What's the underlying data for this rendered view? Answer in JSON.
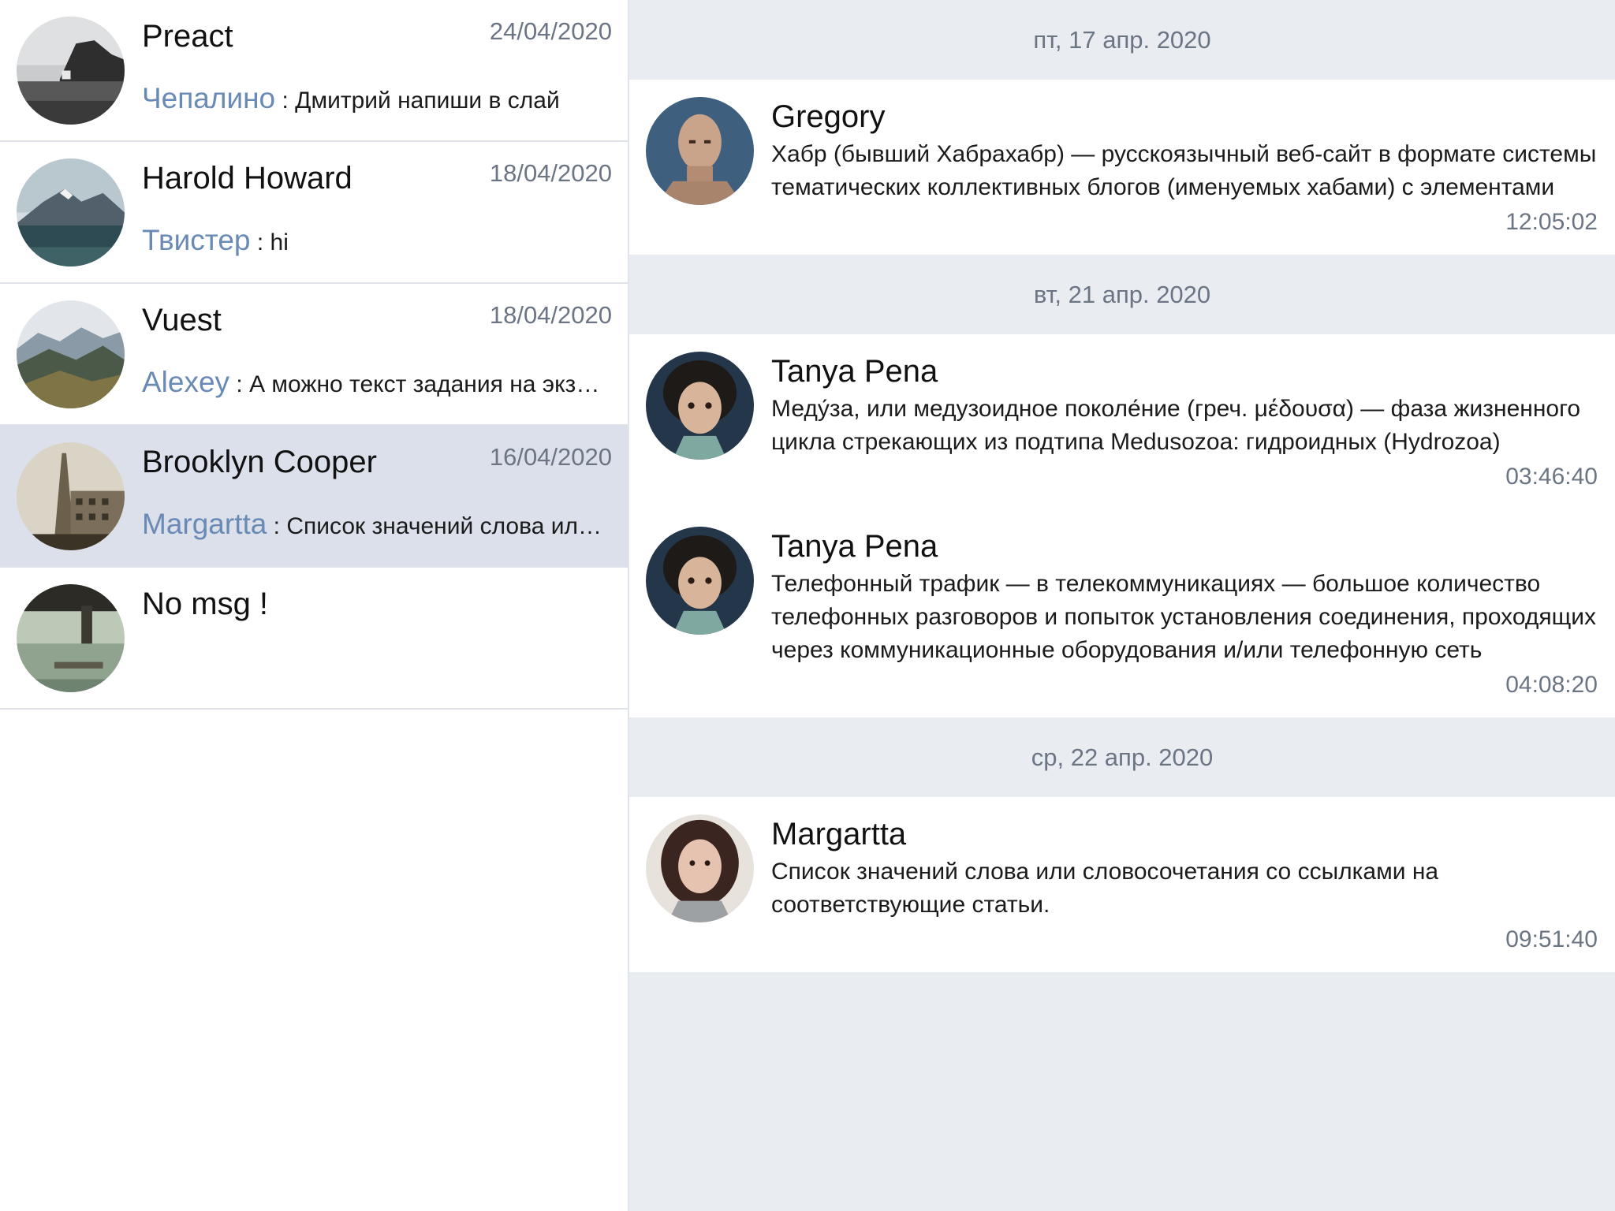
{
  "sidebar": {
    "chats": [
      {
        "name": "Preact",
        "date": "24/04/2020",
        "preview_author": "Чепалино",
        "preview_text": " : Дмитрий напиши в слай",
        "avatar_icon": "landscape-coast-avatar",
        "active": false
      },
      {
        "name": "Harold Howard",
        "date": "18/04/2020",
        "preview_author": "Твистер",
        "preview_text": " : hi",
        "avatar_icon": "mountain-lake-avatar",
        "active": false
      },
      {
        "name": "Vuest",
        "date": "18/04/2020",
        "preview_author": "Alexey",
        "preview_text": " : А можно текст задания на экзамен",
        "avatar_icon": "mountain-range-avatar",
        "active": false
      },
      {
        "name": "Brooklyn Cooper",
        "date": "16/04/2020",
        "preview_author": "Margartta",
        "preview_text": " : Список значений слова или словосочетания",
        "avatar_icon": "city-tower-avatar",
        "active": true
      },
      {
        "name": "No msg !",
        "date": "",
        "preview_author": "",
        "preview_text": "",
        "avatar_icon": "bridge-river-avatar",
        "active": false
      }
    ]
  },
  "messages": {
    "groups": [
      {
        "date": "пт, 17 апр. 2020",
        "items": [
          {
            "author": "Gregory",
            "text": "Хабр (бывший Хабрахабр) — русскоязычный веб-сайт в формате системы тематических коллективных блогов (именуемых хабами) с элементами",
            "time": "12:05:02",
            "avatar_icon": "man-portrait-avatar"
          }
        ]
      },
      {
        "date": "вт, 21 апр. 2020",
        "items": [
          {
            "author": "Tanya Pena",
            "text": "Меду́за, или медузоидное поколе́ние (греч. μέδουσα) — фаза жизненного цикла стрекающих из подтипа Medusozoa: гидроидных (Hydrozoa)",
            "time": "03:46:40",
            "avatar_icon": "child-portrait-avatar"
          },
          {
            "author": "Tanya Pena",
            "text": "Телефонный трафик — в телекоммуникациях — большое количество телефонных разговоров и попыток установления соединения, проходящих через коммуникационные оборудования и/или телефонную сеть",
            "time": "04:08:20",
            "avatar_icon": "child-portrait-avatar"
          }
        ]
      },
      {
        "date": "ср, 22 апр. 2020",
        "items": [
          {
            "author": "Margartta",
            "text": "Список значений слова или словосочетания со ссылками на соответствующие статьи.",
            "time": "09:51:40",
            "avatar_icon": "woman-portrait-avatar"
          }
        ]
      }
    ]
  },
  "colors": {
    "active_row": "#dbe0ea",
    "pane_background": "#e9ecf1",
    "author_link": "#6a8ab6",
    "muted_text": "#6b7583"
  }
}
